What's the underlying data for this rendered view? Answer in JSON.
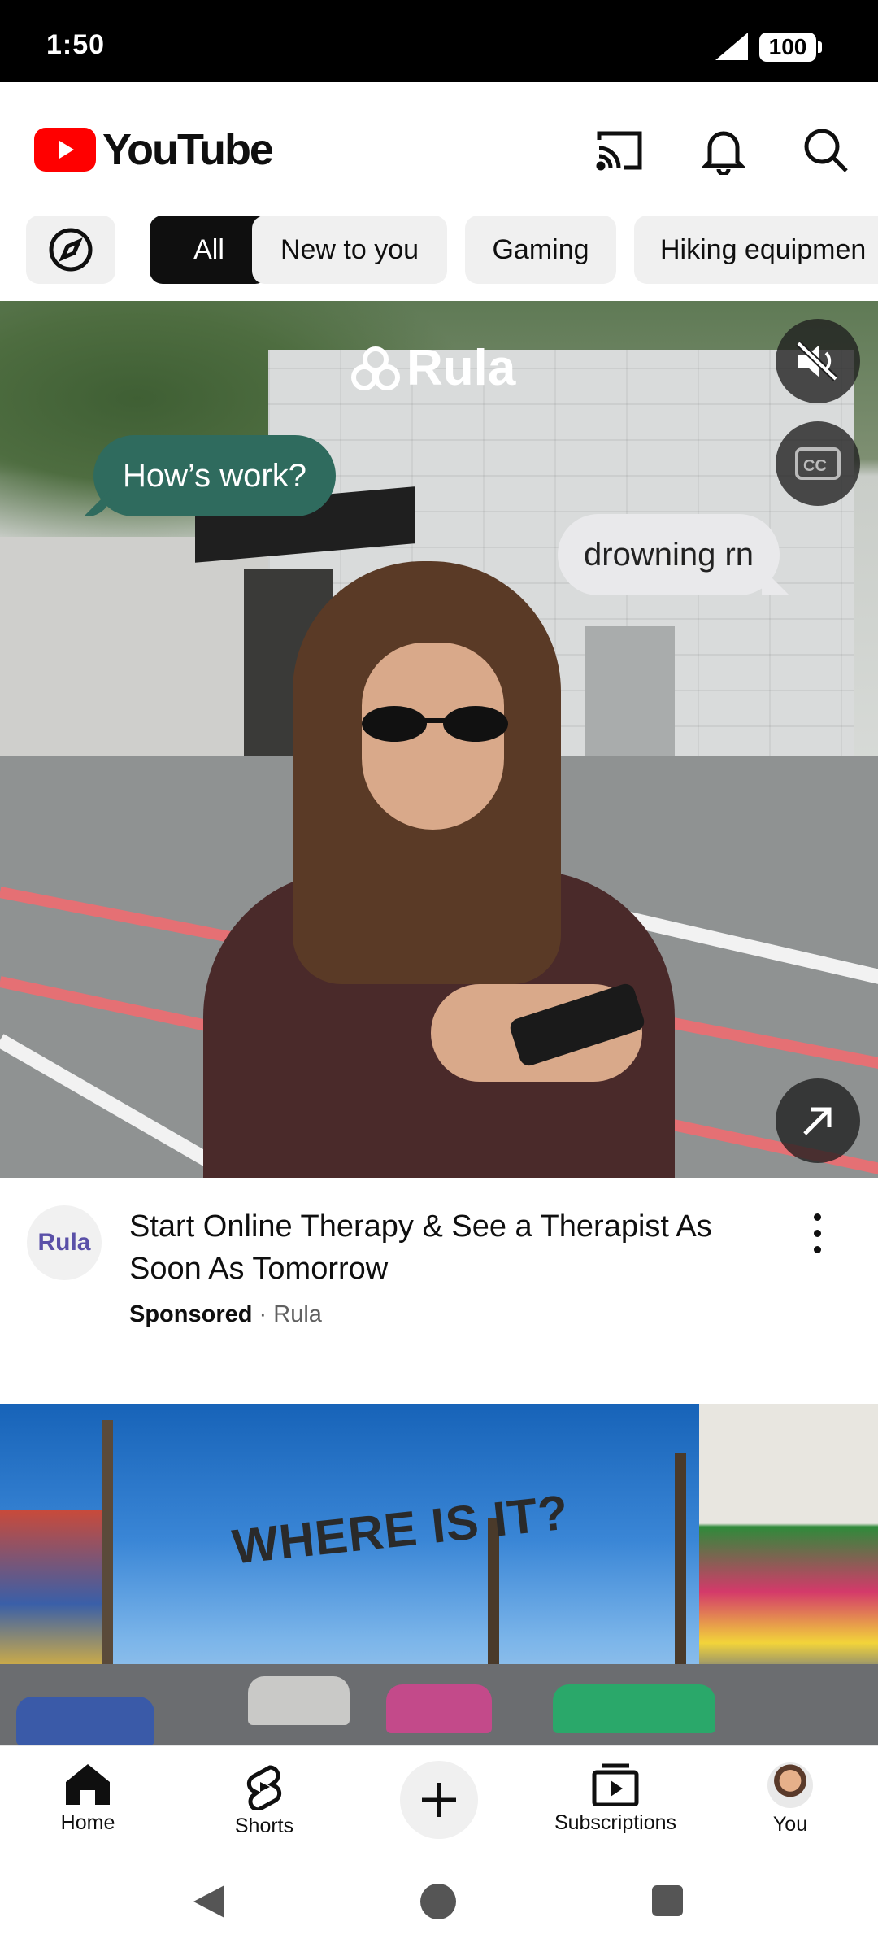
{
  "status_bar": {
    "time": "1:50",
    "battery": "100"
  },
  "header": {
    "logo_text": "YouTube",
    "icons": [
      "cast-icon",
      "bell-icon",
      "search-icon"
    ]
  },
  "chips": {
    "explore_icon": "compass-icon",
    "items": [
      "All",
      "New to you",
      "Gaming",
      "Hiking equipmen"
    ],
    "active": "All"
  },
  "ad": {
    "brand_overlay": "Rula",
    "bubble_left": "How’s work?",
    "bubble_right": "drowning rn",
    "title": "Start Online Therapy & See a Therapist As Soon As Tomorrow",
    "sponsored_label": "Sponsored",
    "separator": "·",
    "advertiser": "Rula",
    "avatar_text": "Rula",
    "controls": [
      "mute-icon",
      "captions-icon",
      "open-external-icon"
    ]
  },
  "video2": {
    "thumbnail_text": "WHERE IS IT?"
  },
  "bottom_nav": {
    "items": [
      {
        "label": "Home",
        "icon": "home-icon"
      },
      {
        "label": "Shorts",
        "icon": "shorts-icon"
      },
      {
        "label": "",
        "icon": "create-plus-icon"
      },
      {
        "label": "Subscriptions",
        "icon": "subscriptions-icon"
      },
      {
        "label": "You",
        "icon": "avatar"
      }
    ]
  },
  "colors": {
    "brand_red": "#ff0000",
    "chip_active": "#0f0f0f",
    "chip_bg": "#f0f0f0",
    "bubble_green": "#2f6b5e"
  }
}
